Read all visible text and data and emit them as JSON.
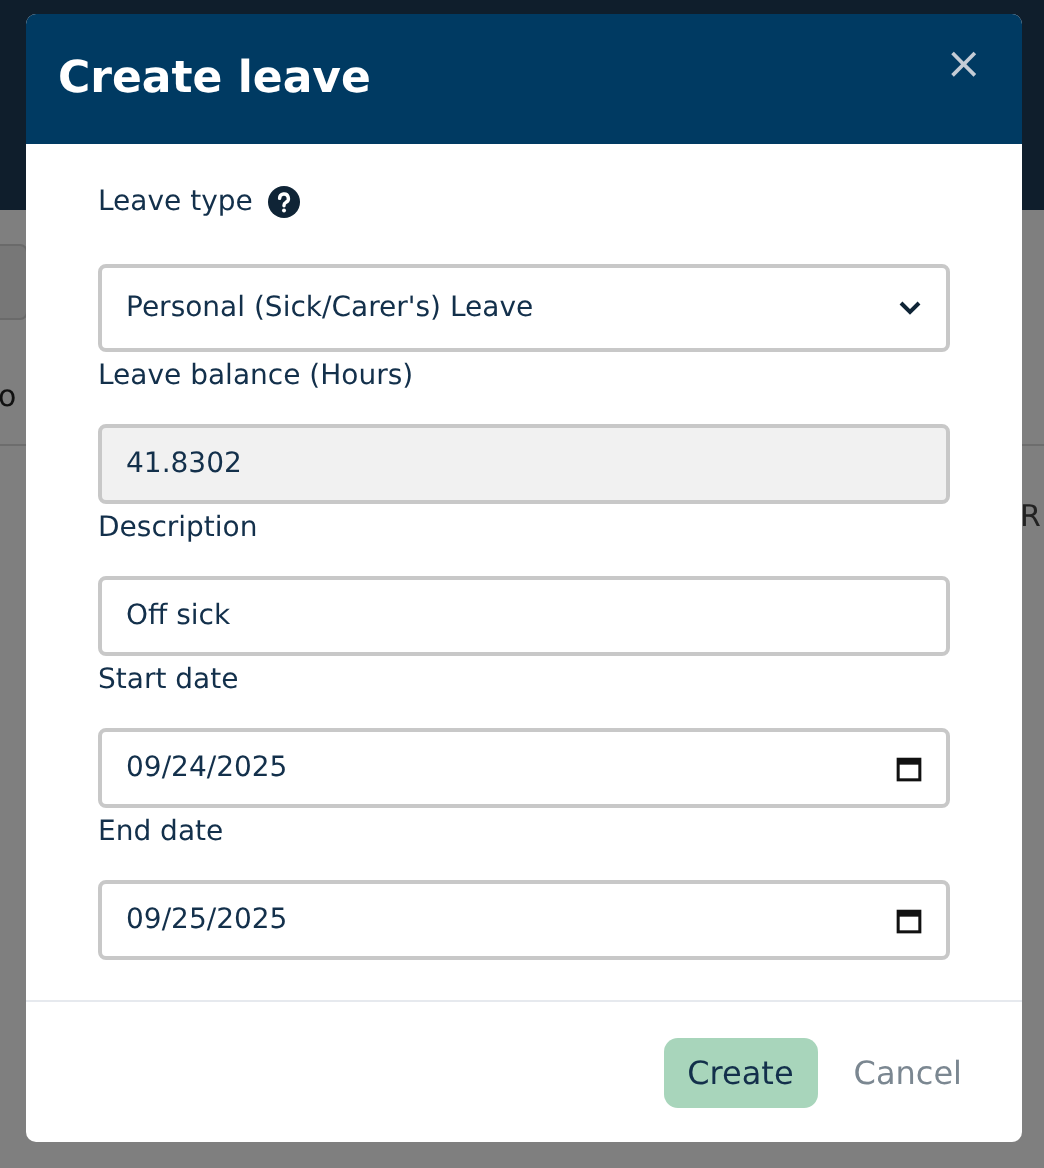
{
  "background": {
    "left_text": "o",
    "right_text": "R"
  },
  "dialog": {
    "title": "Create leave",
    "close": "×"
  },
  "fields": [
    {
      "kind": "select",
      "label": "Leave type",
      "help": true,
      "value": "Personal (Sick/Carer's) Leave",
      "disabled": false
    },
    {
      "kind": "text",
      "label": "Leave balance (Hours)",
      "value": "41.8302",
      "disabled": true
    },
    {
      "kind": "text",
      "label": "Description",
      "value": "Off sick",
      "disabled": false
    },
    {
      "kind": "date",
      "label": "Start date",
      "value": "09/24/2025",
      "disabled": false
    },
    {
      "kind": "date",
      "label": "End date",
      "value": "09/25/2025",
      "disabled": false
    }
  ],
  "buttons": [
    {
      "label": "Create",
      "kind": "primary"
    },
    {
      "label": "Cancel",
      "kind": "link"
    }
  ]
}
